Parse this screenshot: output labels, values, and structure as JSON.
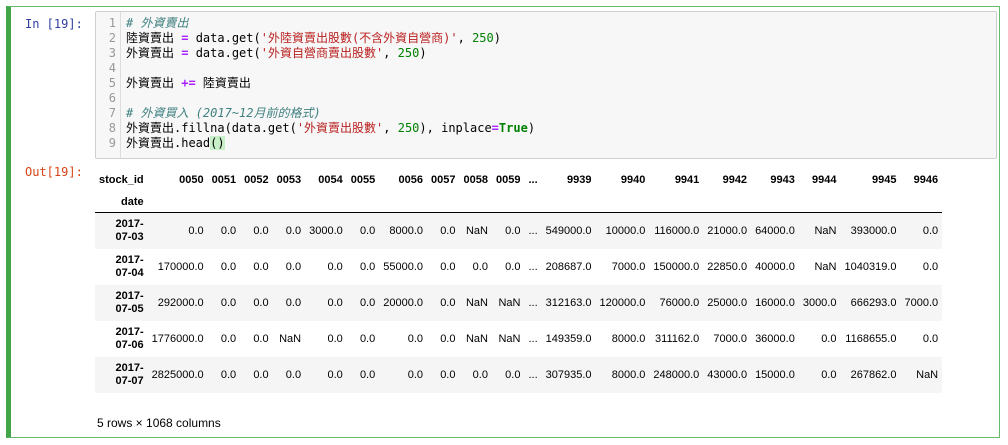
{
  "in_prompt": "In [19]:",
  "out_prompt": "Out[19]:",
  "code_lines": [
    {
      "n": "1",
      "tokens": [
        {
          "t": "# 外資賣出",
          "c": "cm"
        }
      ]
    },
    {
      "n": "2",
      "tokens": [
        {
          "t": "陸資賣出 ",
          "c": "var"
        },
        {
          "t": "=",
          "c": "op"
        },
        {
          "t": " data.get(",
          "c": "var"
        },
        {
          "t": "'外陸資賣出股數(不含外資自營商)'",
          "c": "str"
        },
        {
          "t": ", ",
          "c": "var"
        },
        {
          "t": "250",
          "c": "num"
        },
        {
          "t": ")",
          "c": "var"
        }
      ]
    },
    {
      "n": "3",
      "tokens": [
        {
          "t": "外資賣出 ",
          "c": "var"
        },
        {
          "t": "=",
          "c": "op"
        },
        {
          "t": " data.get(",
          "c": "var"
        },
        {
          "t": "'外資自營商賣出股數'",
          "c": "str"
        },
        {
          "t": ", ",
          "c": "var"
        },
        {
          "t": "250",
          "c": "num"
        },
        {
          "t": ")",
          "c": "var"
        }
      ]
    },
    {
      "n": "4",
      "tokens": []
    },
    {
      "n": "5",
      "tokens": [
        {
          "t": "外資賣出 ",
          "c": "var"
        },
        {
          "t": "+=",
          "c": "op"
        },
        {
          "t": " 陸資賣出",
          "c": "var"
        }
      ]
    },
    {
      "n": "6",
      "tokens": []
    },
    {
      "n": "7",
      "tokens": [
        {
          "t": "# 外資買入 (2017~12月前的格式)",
          "c": "cm"
        }
      ]
    },
    {
      "n": "8",
      "tokens": [
        {
          "t": "外資賣出.fillna(data.get(",
          "c": "var"
        },
        {
          "t": "'外資賣出股數'",
          "c": "str"
        },
        {
          "t": ", ",
          "c": "var"
        },
        {
          "t": "250",
          "c": "num"
        },
        {
          "t": "), inplace",
          "c": "var"
        },
        {
          "t": "=",
          "c": "op"
        },
        {
          "t": "True",
          "c": "kw"
        },
        {
          "t": ")",
          "c": "var"
        }
      ]
    },
    {
      "n": "9",
      "tokens": [
        {
          "t": "外資賣出.head",
          "c": "var"
        },
        {
          "t": "()",
          "c": "cursor-paren"
        }
      ]
    }
  ],
  "table": {
    "columns_name": "stock_id",
    "index_name": "date",
    "columns": [
      "0050",
      "0051",
      "0052",
      "0053",
      "0054",
      "0055",
      "0056",
      "0057",
      "0058",
      "0059",
      "...",
      "9939",
      "9940",
      "9941",
      "9942",
      "9943",
      "9944",
      "9945",
      "9946"
    ],
    "rows": [
      {
        "date_a": "2017-",
        "date_b": "07-03",
        "cells": [
          "0.0",
          "0.0",
          "0.0",
          "0.0",
          "3000.0",
          "0.0",
          "8000.0",
          "0.0",
          "NaN",
          "0.0",
          "...",
          "549000.0",
          "10000.0",
          "116000.0",
          "21000.0",
          "64000.0",
          "NaN",
          "393000.0",
          "0.0"
        ]
      },
      {
        "date_a": "2017-",
        "date_b": "07-04",
        "cells": [
          "170000.0",
          "0.0",
          "0.0",
          "0.0",
          "0.0",
          "0.0",
          "55000.0",
          "0.0",
          "0.0",
          "0.0",
          "...",
          "208687.0",
          "7000.0",
          "150000.0",
          "22850.0",
          "40000.0",
          "NaN",
          "1040319.0",
          "0.0"
        ]
      },
      {
        "date_a": "2017-",
        "date_b": "07-05",
        "cells": [
          "292000.0",
          "0.0",
          "0.0",
          "0.0",
          "0.0",
          "0.0",
          "20000.0",
          "0.0",
          "NaN",
          "NaN",
          "...",
          "312163.0",
          "120000.0",
          "76000.0",
          "25000.0",
          "16000.0",
          "3000.0",
          "666293.0",
          "7000.0"
        ]
      },
      {
        "date_a": "2017-",
        "date_b": "07-06",
        "cells": [
          "1776000.0",
          "0.0",
          "0.0",
          "NaN",
          "0.0",
          "0.0",
          "0.0",
          "0.0",
          "NaN",
          "NaN",
          "...",
          "149359.0",
          "8000.0",
          "311162.0",
          "7000.0",
          "36000.0",
          "0.0",
          "1168655.0",
          "0.0"
        ]
      },
      {
        "date_a": "2017-",
        "date_b": "07-07",
        "cells": [
          "2825000.0",
          "0.0",
          "0.0",
          "0.0",
          "0.0",
          "0.0",
          "0.0",
          "0.0",
          "0.0",
          "0.0",
          "...",
          "307935.0",
          "8000.0",
          "248000.0",
          "43000.0",
          "15000.0",
          "0.0",
          "267862.0",
          "NaN"
        ]
      }
    ]
  },
  "summary": "5 rows × 1068 columns"
}
